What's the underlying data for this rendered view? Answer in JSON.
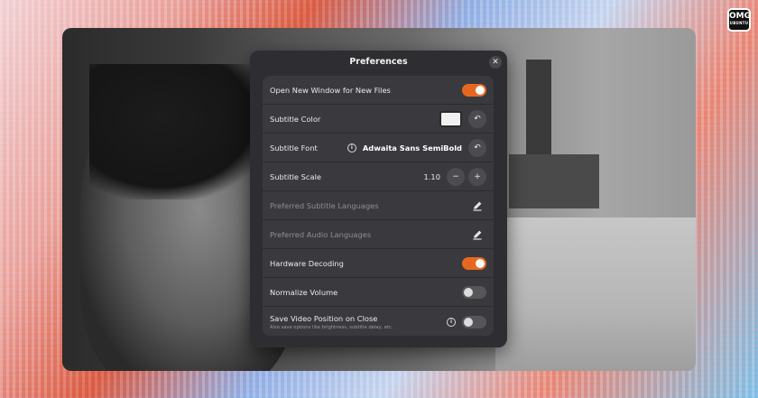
{
  "brand": {
    "line1": "OMG",
    "line2": "UBUNTU"
  },
  "dialog": {
    "title": "Preferences",
    "close_symbol": "✕"
  },
  "rows": {
    "new_window": {
      "label": "Open New Window for New Files",
      "state": "on"
    },
    "subtitle_color": {
      "label": "Subtitle Color",
      "value": "#f0f0f0"
    },
    "subtitle_font": {
      "label": "Subtitle Font",
      "value": "Adwaita Sans SemiBold"
    },
    "subtitle_scale": {
      "label": "Subtitle Scale",
      "value": "1.10",
      "minus": "−",
      "plus": "+"
    },
    "subtitle_languages": {
      "label": "Preferred Subtitle Languages"
    },
    "audio_languages": {
      "label": "Preferred Audio Languages"
    },
    "hardware_decoding": {
      "label": "Hardware Decoding",
      "state": "on"
    },
    "normalize_volume": {
      "label": "Normalize Volume",
      "state": "off"
    },
    "save_position": {
      "label": "Save Video Position on Close",
      "sublabel": "Also save options like brightness, subtitle delay, etc.",
      "state": "off"
    }
  },
  "icons": {
    "reset": "↶",
    "info": "i"
  },
  "colors": {
    "accent": "#e66820",
    "dialog_bg": "#2e2e32",
    "row_bg": "#3a3a3e"
  }
}
